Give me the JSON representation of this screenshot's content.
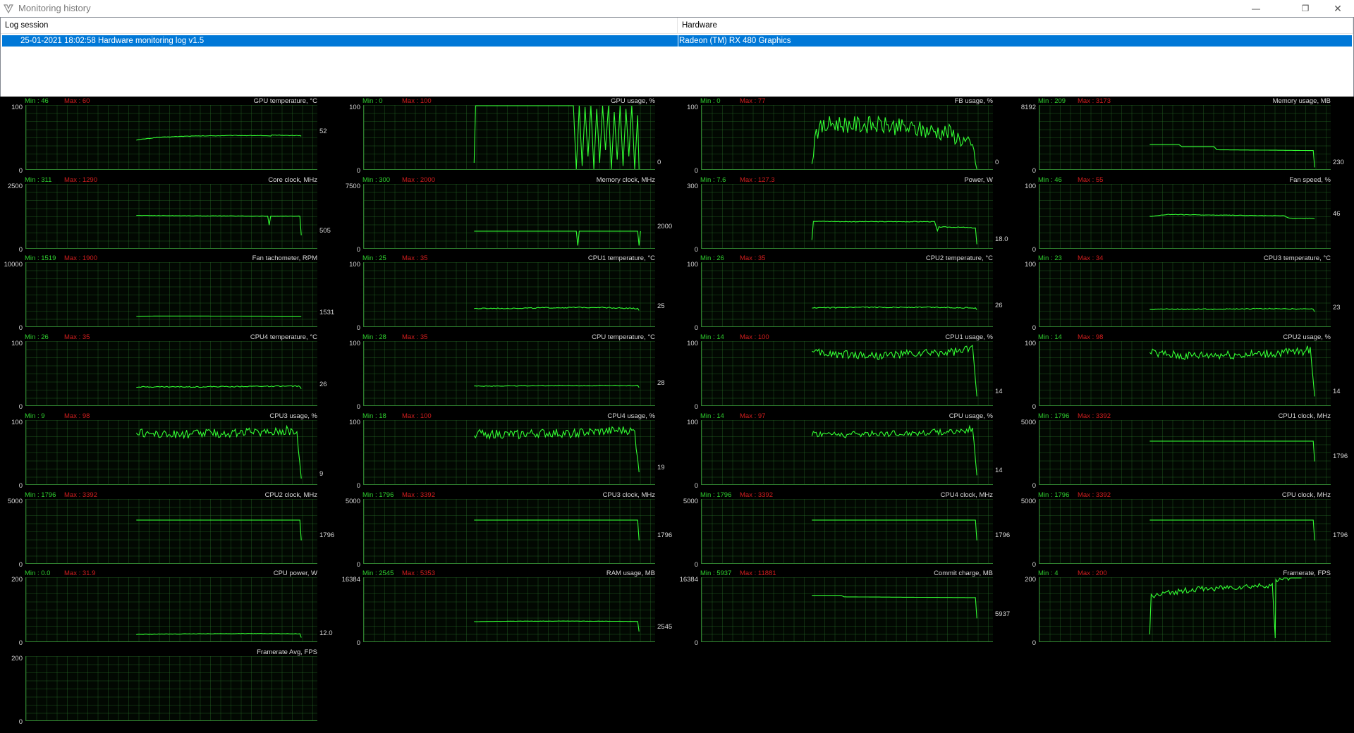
{
  "window": {
    "title": "Monitoring history",
    "controls": {
      "minimize": "—",
      "restore": "❐",
      "close": "✕"
    }
  },
  "list": {
    "columns": [
      "Log session",
      "Hardware"
    ],
    "rows": [
      {
        "session": "25-01-2021 18:02:58 Hardware monitoring log v1.5",
        "hardware": "Radeon (TM) RX 480 Graphics"
      }
    ]
  },
  "colors": {
    "line": "#33ff33",
    "min_label": "#2fd02f",
    "max_label": "#d21e1e",
    "selection": "#0078d7"
  },
  "graphs": [
    {
      "title": "GPU temperature, °C",
      "min": "Min : 46",
      "max": "Max : 60",
      "ymax": "100",
      "ymin": "0",
      "current": "52",
      "ylim": [
        0,
        100
      ],
      "points": [
        [
          0.38,
          46
        ],
        [
          0.45,
          50
        ],
        [
          0.55,
          52
        ],
        [
          0.7,
          53
        ],
        [
          0.8,
          53
        ],
        [
          0.84,
          52
        ],
        [
          0.845,
          54
        ],
        [
          0.9,
          53
        ],
        [
          0.94,
          53
        ],
        [
          0.945,
          52
        ]
      ],
      "noise": 0.4
    },
    {
      "title": "GPU usage, %",
      "min": "Min : 0",
      "max": "Max : 100",
      "ymax": "100",
      "ymin": "0",
      "current": "0",
      "ylim": [
        0,
        100
      ],
      "points": [
        [
          0.38,
          10
        ],
        [
          0.385,
          100
        ],
        [
          0.7,
          100
        ],
        [
          0.72,
          100
        ],
        [
          0.73,
          0
        ],
        [
          0.74,
          100
        ],
        [
          0.75,
          5
        ],
        [
          0.76,
          98
        ],
        [
          0.77,
          20
        ],
        [
          0.78,
          100
        ],
        [
          0.79,
          0
        ],
        [
          0.8,
          95
        ],
        [
          0.81,
          10
        ],
        [
          0.82,
          100
        ],
        [
          0.83,
          30
        ],
        [
          0.84,
          100
        ],
        [
          0.85,
          0
        ],
        [
          0.86,
          90
        ],
        [
          0.87,
          15
        ],
        [
          0.88,
          100
        ],
        [
          0.89,
          5
        ],
        [
          0.9,
          95
        ],
        [
          0.91,
          20
        ],
        [
          0.92,
          100
        ],
        [
          0.93,
          0
        ],
        [
          0.94,
          85
        ],
        [
          0.945,
          0
        ]
      ],
      "noise": 0
    },
    {
      "title": "FB usage, %",
      "min": "Min : 0",
      "max": "Max : 77",
      "ymax": "100",
      "ymin": "0",
      "current": "0",
      "ylim": [
        0,
        100
      ],
      "points": [
        [
          0.38,
          2
        ],
        [
          0.39,
          60
        ],
        [
          0.45,
          72
        ],
        [
          0.55,
          70
        ],
        [
          0.65,
          68
        ],
        [
          0.75,
          62
        ],
        [
          0.85,
          58
        ],
        [
          0.9,
          45
        ],
        [
          0.935,
          30
        ],
        [
          0.945,
          0
        ]
      ],
      "noise": 14
    },
    {
      "title": "Memory usage, MB",
      "min": "Min : 209",
      "max": "Max : 3173",
      "ymax": "8192",
      "ymin": "0",
      "current": "230",
      "ylim": [
        0,
        8192
      ],
      "points": [
        [
          0.38,
          3173
        ],
        [
          0.48,
          3173
        ],
        [
          0.49,
          2900
        ],
        [
          0.6,
          2900
        ],
        [
          0.61,
          2500
        ],
        [
          0.8,
          2450
        ],
        [
          0.94,
          2400
        ],
        [
          0.945,
          230
        ]
      ],
      "noise": 0
    },
    {
      "title": "Core clock, MHz",
      "min": "Min : 311",
      "max": "Max : 1290",
      "ymax": "2500",
      "ymin": "0",
      "current": "505",
      "ylim": [
        0,
        2500
      ],
      "points": [
        [
          0.38,
          1290
        ],
        [
          0.6,
          1270
        ],
        [
          0.83,
          1260
        ],
        [
          0.835,
          900
        ],
        [
          0.84,
          1260
        ],
        [
          0.94,
          1260
        ],
        [
          0.945,
          505
        ]
      ],
      "noise": 8
    },
    {
      "title": "Memory clock, MHz",
      "min": "Min : 300",
      "max": "Max : 2000",
      "ymax": "7500",
      "ymin": "0",
      "current": "2000",
      "ylim": [
        0,
        7500
      ],
      "points": [
        [
          0.38,
          2000
        ],
        [
          0.73,
          2000
        ],
        [
          0.735,
          300
        ],
        [
          0.74,
          2000
        ],
        [
          0.94,
          2000
        ],
        [
          0.945,
          300
        ],
        [
          0.95,
          2000
        ]
      ],
      "noise": 0
    },
    {
      "title": "Power, W",
      "min": "Min : 7.6",
      "max": "Max : 127.3",
      "ymax": "300",
      "ymin": "0",
      "current": "18.0",
      "ylim": [
        0,
        300
      ],
      "points": [
        [
          0.38,
          40
        ],
        [
          0.385,
          127
        ],
        [
          0.5,
          125
        ],
        [
          0.7,
          125
        ],
        [
          0.8,
          125
        ],
        [
          0.81,
          80
        ],
        [
          0.815,
          100
        ],
        [
          0.9,
          98
        ],
        [
          0.94,
          95
        ],
        [
          0.945,
          18
        ]
      ],
      "noise": 1.5
    },
    {
      "title": "Fan speed, %",
      "min": "Min : 46",
      "max": "Max : 55",
      "ymax": "100",
      "ymin": "0",
      "current": "46",
      "ylim": [
        0,
        100
      ],
      "points": [
        [
          0.38,
          50
        ],
        [
          0.44,
          53
        ],
        [
          0.6,
          52
        ],
        [
          0.8,
          51
        ],
        [
          0.84,
          51
        ],
        [
          0.86,
          47
        ],
        [
          0.94,
          47
        ],
        [
          0.945,
          46
        ]
      ],
      "noise": 0.4
    },
    {
      "title": "Fan tachometer, RPM",
      "min": "Min : 1519",
      "max": "Max : 1900",
      "ymax": "10000",
      "ymin": "0",
      "current": "1531",
      "ylim": [
        0,
        10000
      ],
      "points": [
        [
          0.38,
          1550
        ],
        [
          0.44,
          1620
        ],
        [
          0.6,
          1620
        ],
        [
          0.8,
          1600
        ],
        [
          0.86,
          1540
        ],
        [
          0.945,
          1531
        ]
      ],
      "noise": 0
    },
    {
      "title": "CPU1 temperature, °C",
      "min": "Min : 25",
      "max": "Max : 35",
      "ymax": "100",
      "ymin": "0",
      "current": "25",
      "ylim": [
        0,
        100
      ],
      "points": [
        [
          0.38,
          28
        ],
        [
          0.6,
          29
        ],
        [
          0.8,
          30
        ],
        [
          0.94,
          28
        ],
        [
          0.945,
          25
        ]
      ],
      "noise": 0.8
    },
    {
      "title": "CPU2 temperature, °C",
      "min": "Min : 26",
      "max": "Max : 35",
      "ymax": "100",
      "ymin": "0",
      "current": "26",
      "ylim": [
        0,
        100
      ],
      "points": [
        [
          0.38,
          29
        ],
        [
          0.6,
          30
        ],
        [
          0.8,
          30
        ],
        [
          0.94,
          29
        ],
        [
          0.945,
          26
        ]
      ],
      "noise": 0.8
    },
    {
      "title": "CPU3 temperature, °C",
      "min": "Min : 23",
      "max": "Max : 34",
      "ymax": "100",
      "ymin": "0",
      "current": "23",
      "ylim": [
        0,
        100
      ],
      "points": [
        [
          0.38,
          27
        ],
        [
          0.6,
          27
        ],
        [
          0.8,
          28
        ],
        [
          0.94,
          27
        ],
        [
          0.945,
          23
        ]
      ],
      "noise": 0.8
    },
    {
      "title": "CPU4 temperature, °C",
      "min": "Min : 26",
      "max": "Max : 35",
      "ymax": "100",
      "ymin": "0",
      "current": "26",
      "ylim": [
        0,
        100
      ],
      "points": [
        [
          0.38,
          29
        ],
        [
          0.6,
          29
        ],
        [
          0.8,
          30
        ],
        [
          0.94,
          30
        ],
        [
          0.945,
          26
        ]
      ],
      "noise": 0.8
    },
    {
      "title": "CPU temperature, °C",
      "min": "Min : 28",
      "max": "Max : 35",
      "ymax": "100",
      "ymin": "0",
      "current": "28",
      "ylim": [
        0,
        100
      ],
      "points": [
        [
          0.38,
          30
        ],
        [
          0.6,
          31
        ],
        [
          0.8,
          31
        ],
        [
          0.94,
          31
        ],
        [
          0.945,
          28
        ]
      ],
      "noise": 0.6
    },
    {
      "title": "CPU1 usage, %",
      "min": "Min : 14",
      "max": "Max : 100",
      "ymax": "100",
      "ymin": "0",
      "current": "14",
      "ylim": [
        0,
        100
      ],
      "points": [
        [
          0.38,
          82
        ],
        [
          0.5,
          80
        ],
        [
          0.6,
          78
        ],
        [
          0.7,
          80
        ],
        [
          0.8,
          82
        ],
        [
          0.9,
          85
        ],
        [
          0.93,
          90
        ],
        [
          0.945,
          14
        ]
      ],
      "noise": 7
    },
    {
      "title": "CPU2 usage, %",
      "min": "Min : 14",
      "max": "Max : 98",
      "ymax": "100",
      "ymin": "0",
      "current": "14",
      "ylim": [
        0,
        100
      ],
      "points": [
        [
          0.38,
          82
        ],
        [
          0.5,
          78
        ],
        [
          0.6,
          80
        ],
        [
          0.7,
          80
        ],
        [
          0.8,
          82
        ],
        [
          0.9,
          85
        ],
        [
          0.93,
          88
        ],
        [
          0.945,
          14
        ]
      ],
      "noise": 7
    },
    {
      "title": "CPU3 usage, %",
      "min": "Min : 9",
      "max": "Max : 98",
      "ymax": "100",
      "ymin": "0",
      "current": "9",
      "ylim": [
        0,
        100
      ],
      "points": [
        [
          0.38,
          82
        ],
        [
          0.5,
          78
        ],
        [
          0.6,
          80
        ],
        [
          0.7,
          80
        ],
        [
          0.8,
          82
        ],
        [
          0.9,
          85
        ],
        [
          0.93,
          80
        ],
        [
          0.945,
          9
        ]
      ],
      "noise": 7
    },
    {
      "title": "CPU4 usage, %",
      "min": "Min : 18",
      "max": "Max : 100",
      "ymax": "100",
      "ymin": "0",
      "current": "19",
      "ylim": [
        0,
        100
      ],
      "points": [
        [
          0.38,
          80
        ],
        [
          0.5,
          78
        ],
        [
          0.6,
          80
        ],
        [
          0.7,
          80
        ],
        [
          0.8,
          82
        ],
        [
          0.9,
          85
        ],
        [
          0.93,
          82
        ],
        [
          0.945,
          19
        ]
      ],
      "noise": 7
    },
    {
      "title": "CPU usage, %",
      "min": "Min : 14",
      "max": "Max : 97",
      "ymax": "100",
      "ymin": "0",
      "current": "14",
      "ylim": [
        0,
        100
      ],
      "points": [
        [
          0.38,
          80
        ],
        [
          0.5,
          78
        ],
        [
          0.6,
          80
        ],
        [
          0.7,
          80
        ],
        [
          0.8,
          82
        ],
        [
          0.9,
          84
        ],
        [
          0.93,
          88
        ],
        [
          0.945,
          14
        ]
      ],
      "noise": 5
    },
    {
      "title": "CPU1 clock, MHz",
      "min": "Min : 1796",
      "max": "Max : 3392",
      "ymax": "5000",
      "ymin": "0",
      "current": "1796",
      "ylim": [
        0,
        5000
      ],
      "points": [
        [
          0.38,
          3392
        ],
        [
          0.94,
          3392
        ],
        [
          0.945,
          1796
        ]
      ],
      "noise": 0
    },
    {
      "title": "CPU2 clock, MHz",
      "min": "Min : 1796",
      "max": "Max : 3392",
      "ymax": "5000",
      "ymin": "0",
      "current": "1796",
      "ylim": [
        0,
        5000
      ],
      "points": [
        [
          0.38,
          3392
        ],
        [
          0.94,
          3392
        ],
        [
          0.945,
          1796
        ]
      ],
      "noise": 0
    },
    {
      "title": "CPU3 clock, MHz",
      "min": "Min : 1796",
      "max": "Max : 3392",
      "ymax": "5000",
      "ymin": "0",
      "current": "1796",
      "ylim": [
        0,
        5000
      ],
      "points": [
        [
          0.38,
          3392
        ],
        [
          0.94,
          3392
        ],
        [
          0.945,
          1796
        ]
      ],
      "noise": 0
    },
    {
      "title": "CPU4 clock, MHz",
      "min": "Min : 1796",
      "max": "Max : 3392",
      "ymax": "5000",
      "ymin": "0",
      "current": "1796",
      "ylim": [
        0,
        5000
      ],
      "points": [
        [
          0.38,
          3392
        ],
        [
          0.94,
          3392
        ],
        [
          0.945,
          1796
        ]
      ],
      "noise": 0
    },
    {
      "title": "CPU clock, MHz",
      "min": "Min : 1796",
      "max": "Max : 3392",
      "ymax": "5000",
      "ymin": "0",
      "current": "1796",
      "ylim": [
        0,
        5000
      ],
      "points": [
        [
          0.38,
          3392
        ],
        [
          0.94,
          3392
        ],
        [
          0.945,
          1796
        ]
      ],
      "noise": 0
    },
    {
      "title": "CPU power, W",
      "min": "Min : 0.0",
      "max": "Max : 31.9",
      "ymax": "200",
      "ymin": "0",
      "current": "12.0",
      "ylim": [
        0,
        200
      ],
      "points": [
        [
          0.38,
          22
        ],
        [
          0.6,
          24
        ],
        [
          0.8,
          25
        ],
        [
          0.94,
          24
        ],
        [
          0.945,
          12
        ]
      ],
      "noise": 0.8
    },
    {
      "title": "RAM usage, MB",
      "min": "Min : 2545",
      "max": "Max : 5353",
      "ymax": "16384",
      "ymin": "0",
      "current": "2545",
      "ylim": [
        0,
        16384
      ],
      "points": [
        [
          0.38,
          5100
        ],
        [
          0.5,
          5200
        ],
        [
          0.7,
          5250
        ],
        [
          0.94,
          5150
        ],
        [
          0.945,
          2545
        ]
      ],
      "noise": 30
    },
    {
      "title": "Commit charge, MB",
      "min": "Min : 5937",
      "max": "Max : 11881",
      "ymax": "16384",
      "ymin": "0",
      "current": "5937",
      "ylim": [
        0,
        16384
      ],
      "points": [
        [
          0.38,
          11881
        ],
        [
          0.48,
          11881
        ],
        [
          0.49,
          11500
        ],
        [
          0.7,
          11400
        ],
        [
          0.94,
          11300
        ],
        [
          0.945,
          5937
        ]
      ],
      "noise": 0
    },
    {
      "title": "Framerate, FPS",
      "min": "Min : 4",
      "max": "Max : 200",
      "ymax": "200",
      "ymin": "0",
      "current": "",
      "ylim": [
        0,
        200
      ],
      "points": [
        [
          0.38,
          20
        ],
        [
          0.385,
          140
        ],
        [
          0.45,
          155
        ],
        [
          0.55,
          165
        ],
        [
          0.65,
          170
        ],
        [
          0.75,
          175
        ],
        [
          0.8,
          178
        ],
        [
          0.81,
          4
        ],
        [
          0.812,
          190
        ],
        [
          0.83,
          200
        ],
        [
          0.9,
          200
        ]
      ],
      "noise": 9
    },
    {
      "title": "Framerate Avg, FPS",
      "min": "",
      "max": "",
      "ymax": "200",
      "ymin": "0",
      "current": "",
      "ylim": [
        0,
        200
      ],
      "points": [],
      "noise": 0
    }
  ]
}
